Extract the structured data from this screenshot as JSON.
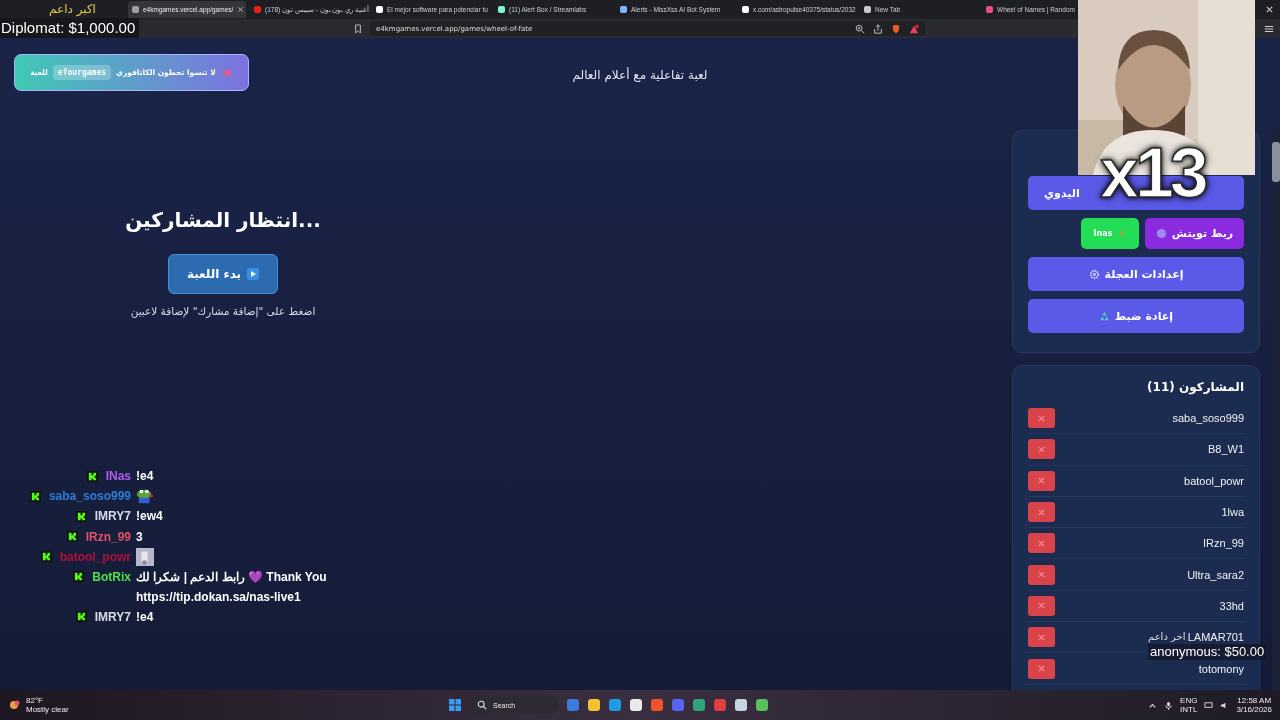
{
  "browser": {
    "tabs": [
      {
        "title": "e4kmgames.vercel.app/games/",
        "selected": true
      },
      {
        "title": "(178) أغنية ري بون بون - سبيس تون",
        "selected": false
      },
      {
        "title": "El mejor software para potenciar tu",
        "selected": false
      },
      {
        "title": "(11) Alert Box / Streamlabs",
        "selected": false
      },
      {
        "title": "Alerts - MissXss AI Bot System",
        "selected": false
      },
      {
        "title": "x.com/astropulse40375/status/2032",
        "selected": false
      },
      {
        "title": "New Tab",
        "selected": false
      },
      {
        "title": "Wheel of Names | Random",
        "selected": false
      }
    ],
    "url": "e4kmgames.vercel.app/games/wheel-of-fate"
  },
  "banner": {
    "before": "لا تنسوا تحطون الكاتاقوري",
    "code": "efourgames",
    "after": "للعبة"
  },
  "subtitle": "لعبة تفاعلية مع أعلام العالم",
  "game": {
    "status": "انتظار المشاركين...",
    "start_button": "بدء اللعبة",
    "hint": "اضغط على \"إضافة مشارك\" لإضافة لاعبين"
  },
  "controls": [
    {
      "kind": "wide",
      "label": "اليدوي"
    },
    {
      "kind": "pair",
      "items": [
        {
          "label": "Inas",
          "color": "#22dd55"
        },
        {
          "label": "ربط تويتش",
          "color": "#8b2be0"
        }
      ]
    },
    {
      "kind": "wide",
      "label": "إعدادات العجلة"
    },
    {
      "kind": "wide",
      "label": "إعادة ضبط"
    }
  ],
  "participants": {
    "title": "المشاركون (11)",
    "names": [
      "saba_soso999",
      "B8_W1",
      "batool_powr",
      "1lwa",
      "IRzn_99",
      "Ultra_sara2",
      "33hd",
      "LAMAR701",
      "totomony"
    ]
  },
  "chat": [
    {
      "user": "INas",
      "color": "#b35cf0",
      "kind": "text",
      "message": "!e4"
    },
    {
      "user": "saba_soso999",
      "color": "#2e7bd6",
      "kind": "emote"
    },
    {
      "user": "IMRY7",
      "color": "#d6dbe8",
      "kind": "text",
      "message": "!ew4"
    },
    {
      "user": "IRzn_99",
      "color": "#e0506a",
      "kind": "text",
      "message": "3"
    },
    {
      "user": "batool_powr",
      "color": "#b0103a"
    },
    {
      "user": "BotRix",
      "color": "#4fe04a",
      "kind": "text",
      "message": "رابط الدعم | شكرا لك 💜 Thank You https://tip.dokan.sa/nas-live1"
    },
    {
      "user": "IMRY7",
      "color": "#d6dbe8",
      "kind": "text",
      "message": "!e4"
    }
  ],
  "stream_overlay": {
    "top_supporter_label": "اكبر داعم",
    "top_supporter": "Diplomat: $1,000.00",
    "multiplier": "x13",
    "last_supporter_label": "اخر داعم",
    "last_supporter": "anonymous: $50.00"
  },
  "taskbar": {
    "temperature": "82°F",
    "weather": "Mostly clear",
    "search": "Search",
    "language": "ENG",
    "layout": "INTL",
    "time": "12:58 AM",
    "date": "3/16/2026"
  }
}
